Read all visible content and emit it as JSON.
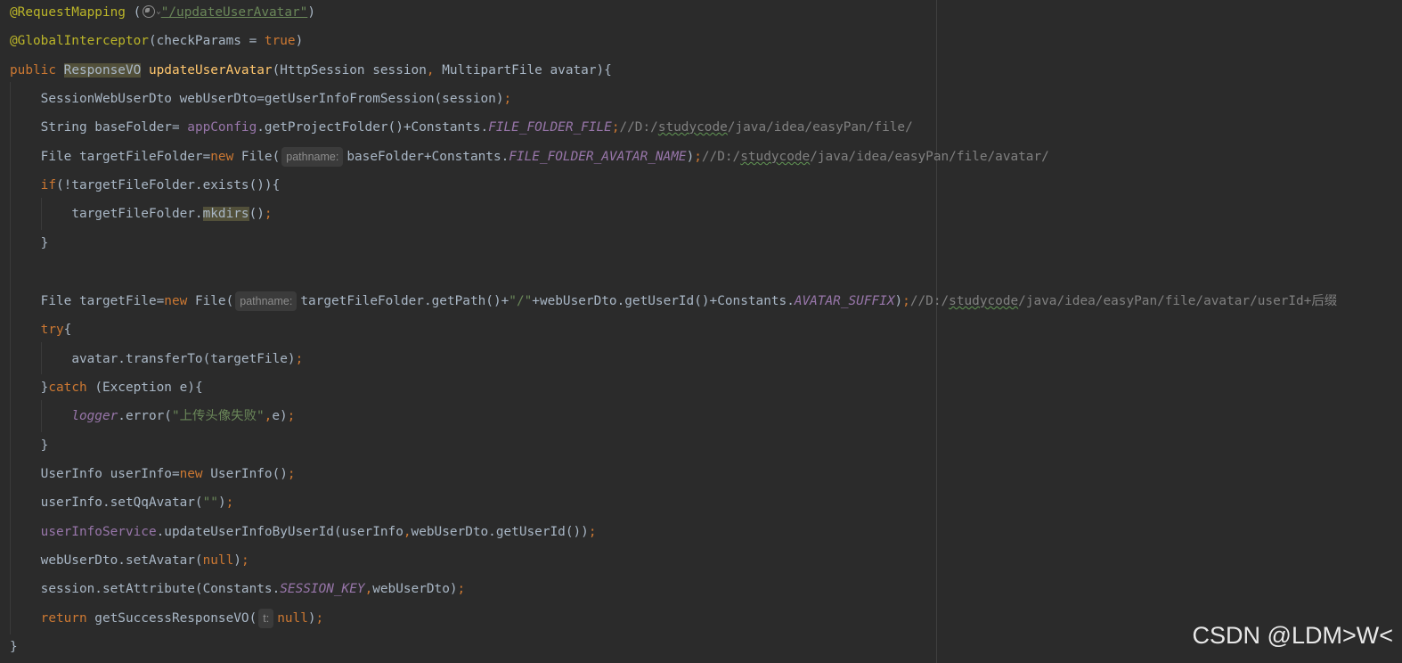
{
  "code": {
    "l1": {
      "annotation": "@RequestMapping",
      "open": " (",
      "url": "\"/updateUserAvatar\"",
      "close": ")"
    },
    "l2": {
      "annotation": "@GlobalInterceptor",
      "args": "(checkParams = ",
      "value": "true",
      "close": ")"
    },
    "l3": {
      "kw": "public",
      "type": "ResponseVO",
      "name": "updateUserAvatar",
      "params1": "(HttpSession session",
      "comma": ",",
      "params2": " MultipartFile avatar){"
    },
    "l4": {
      "code": "SessionWebUserDto webUserDto=getUserInfoFromSession(session)",
      "semi": ";"
    },
    "l5": {
      "pre": "String baseFolder= ",
      "field": "appConfig",
      "mid": ".getProjectFolder()+Constants.",
      "const": "FILE_FOLDER_FILE",
      "semi": ";",
      "c1": "//D:/",
      "c2": "studycode",
      "c3": "/java/idea/easyPan/file/"
    },
    "l6": {
      "pre": "File targetFileFolder=",
      "kw": "new",
      "mid": " File(",
      "hint": "pathname:",
      "args": "baseFolder+Constants.",
      "const": "FILE_FOLDER_AVATAR_NAME",
      "close": ")",
      "semi": ";",
      "c1": "//D:/",
      "c2": "studycode",
      "c3": "/java/idea/easyPan/file/avatar/"
    },
    "l7": {
      "kw": "if",
      "rest": "(!targetFileFolder.exists()){"
    },
    "l8": {
      "pre": "targetFileFolder.",
      "method": "mkdirs",
      "post": "()",
      "semi": ";"
    },
    "l9": {
      "text": "}"
    },
    "l11": {
      "pre": "File targetFile=",
      "kw": "new",
      "mid": " File(",
      "hint": "pathname:",
      "args1": "targetFileFolder.getPath()+",
      "str": "\"/\"",
      "args2": "+webUserDto.getUserId()+Constants.",
      "const": "AVATAR_SUFFIX",
      "close": ")",
      "semi": ";",
      "c1": "//D:/",
      "c2": "studycode",
      "c3": "/java/idea/easyPan/file/avatar/userId+后缀"
    },
    "l12": {
      "kw": "try",
      "rest": "{"
    },
    "l13": {
      "code": "avatar.transferTo(targetFile)",
      "semi": ";"
    },
    "l14": {
      "pre": "}",
      "kw": "catch",
      "rest": " (Exception e){"
    },
    "l15": {
      "field": "logger",
      "mid": ".error(",
      "str": "\"上传头像失败\"",
      "comma": ",",
      "post": "e)",
      "semi": ";"
    },
    "l16": {
      "text": "}"
    },
    "l17": {
      "pre": "UserInfo userInfo=",
      "kw": "new",
      "post": " UserInfo()",
      "semi": ";"
    },
    "l18": {
      "pre": "userInfo.setQqAvatar(",
      "str": "\"\"",
      "post": ")",
      "semi": ";"
    },
    "l19": {
      "field": "userInfoService",
      "mid": ".updateUserInfoByUserId(userInfo",
      "comma": ",",
      "post": "webUserDto.getUserId())",
      "semi": ";"
    },
    "l20": {
      "pre": "webUserDto.setAvatar(",
      "kw": "null",
      "post": ")",
      "semi": ";"
    },
    "l21": {
      "pre": "session.setAttribute(Constants.",
      "const": "SESSION_KEY",
      "comma": ",",
      "post": "webUserDto)",
      "semi": ";"
    },
    "l22": {
      "kw": "return",
      "mid": " getSuccessResponseVO(",
      "hint": "t:",
      "val": "null",
      "post": ")",
      "semi": ";"
    },
    "l23": {
      "text": "}"
    }
  },
  "watermark": "CSDN @LDM>W<",
  "colors": {
    "background": "#2b2b2b",
    "keyword": "#cc7832",
    "annotation": "#bbb529",
    "function": "#ffc66d",
    "string": "#6a8759",
    "comment": "#808080",
    "constant": "#9876aa",
    "text": "#a9b7c6"
  }
}
